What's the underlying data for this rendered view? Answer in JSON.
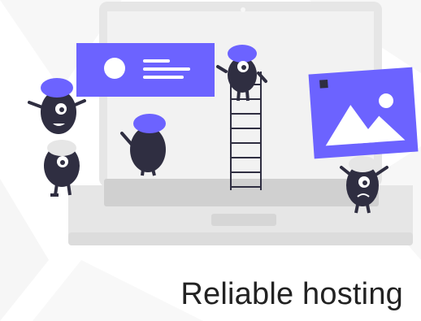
{
  "caption": {
    "text": "Reliable hosting"
  },
  "colors": {
    "accent": "#6c63ff",
    "character": "#2f2e41",
    "laptop_frame": "#e6e6e6",
    "laptop_screen": "#f2f2f2",
    "laptop_base": "#d6d6d6",
    "background_triangles": "#f7f7f7"
  },
  "illustration": {
    "subject": "laptop with monster characters and hosting cards",
    "icons": [
      "profile-card-icon",
      "image-card-icon",
      "ladder-icon",
      "laptop-icon"
    ]
  }
}
